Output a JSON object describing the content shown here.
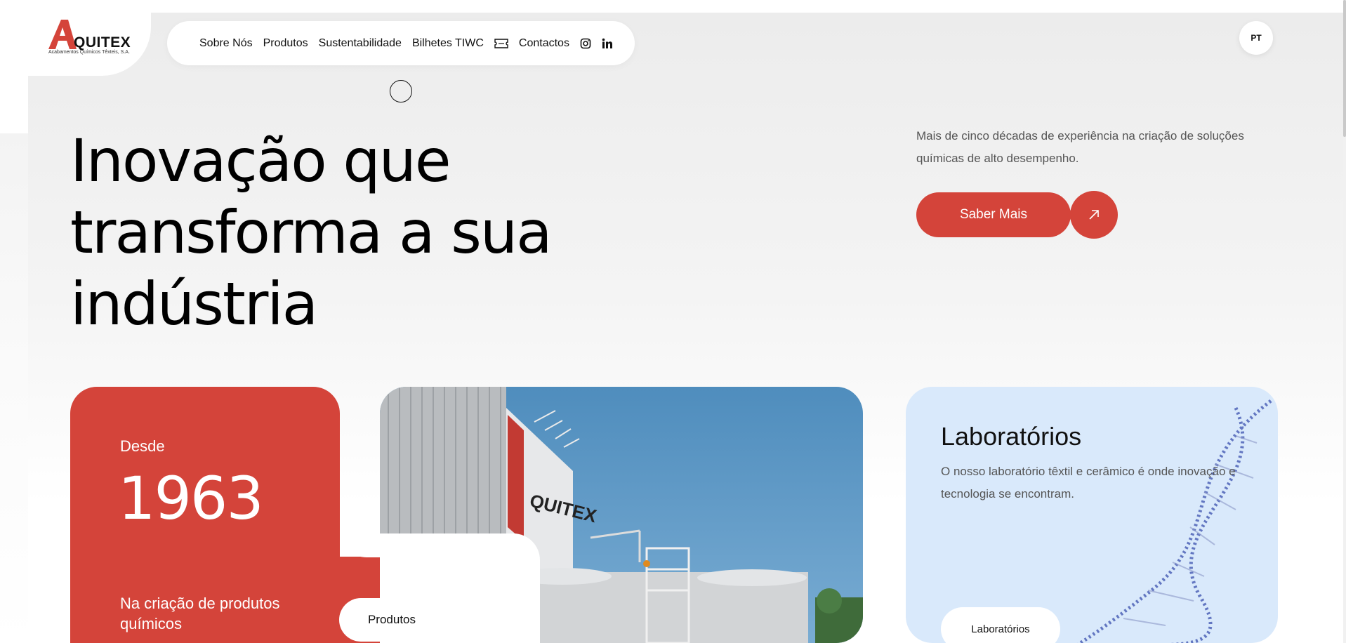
{
  "brand": {
    "wordmark": "QUITEX",
    "tagline": "Acabamentos Químicos Têxteis, S.A.",
    "accent_color": "#d4443a"
  },
  "nav": {
    "items": [
      "Sobre Nós",
      "Produtos",
      "Sustentabilidade",
      "Bilhetes TIWC",
      "Contactos"
    ],
    "ticket_icon": "ticket-icon",
    "social_icons": [
      "instagram-icon",
      "linkedin-icon"
    ]
  },
  "language": "PT",
  "hero": {
    "headline_lines": [
      "Inovação que",
      "transforma a sua",
      "indústria"
    ],
    "intro": "Mais de cinco décadas de experiência na criação de soluções químicas de alto desempenho.",
    "cta_label": "Saber Mais",
    "cta_icon": "arrow-up-right-icon"
  },
  "since_card": {
    "label": "Desde",
    "year": "1963",
    "tagline": "Na criação de produtos químicos",
    "button_label": "Produtos"
  },
  "photo_card": {
    "sign_text": "QUITEX"
  },
  "lab_card": {
    "title": "Laboratórios",
    "text": "O nosso laboratório têxtil e cerâmico é onde inovação e tecnologia se encontram.",
    "button_label": "Laboratórios",
    "background": "#d9e9fb"
  }
}
